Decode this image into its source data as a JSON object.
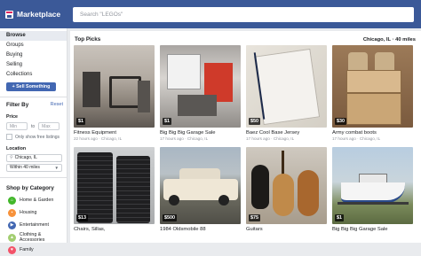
{
  "app": {
    "title": "Marketplace"
  },
  "search": {
    "placeholder": "Search \"LEGOs\""
  },
  "sidebar": {
    "nav": [
      "Browse",
      "Groups",
      "Buying",
      "Selling",
      "Collections"
    ],
    "sell_label": "+ Sell Something",
    "filter_title": "Filter By",
    "reset_label": "Reset",
    "price_label": "Price",
    "min_placeholder": "Min",
    "to_label": "to",
    "max_placeholder": "Max",
    "free_label": "Only show free listings",
    "location_label": "Location",
    "location_value": "Chicago, IL",
    "radius_value": "Within 40 miles",
    "category_title": "Shop by Category",
    "categories": [
      {
        "label": "Home & Garden",
        "icon": "house-icon",
        "color": "#42b72a"
      },
      {
        "label": "Housing",
        "icon": "housing-icon",
        "color": "#f7923b"
      },
      {
        "label": "Entertainment",
        "icon": "entertainment-icon",
        "color": "#4267b2"
      },
      {
        "label": "Clothing & Accessories",
        "icon": "clothing-icon",
        "color": "#a3ce71"
      },
      {
        "label": "Family",
        "icon": "family-icon",
        "color": "#f35369"
      }
    ]
  },
  "main": {
    "section_title": "Top Picks",
    "location": "Chicago, IL · 40 miles",
    "listings": [
      {
        "price": "$1",
        "title": "Fitness Equipment",
        "meta": "22 hours ago · Chicago, IL"
      },
      {
        "price": "$1",
        "title": "Big Big Big Garage Sale",
        "meta": "17 hours ago · Chicago, IL"
      },
      {
        "price": "$50",
        "title": "Baez Cool Base Jersey",
        "meta": "17 hours ago · Chicago, IL"
      },
      {
        "price": "$30",
        "title": "Army combat boots",
        "meta": "17 hours ago · Chicago, IL"
      },
      {
        "price": "$13",
        "title": "Chairs, Sillas,",
        "meta": ""
      },
      {
        "price": "$500",
        "title": "1984 Oldsmobile 88",
        "meta": ""
      },
      {
        "price": "$75",
        "title": "Guitars",
        "meta": ""
      },
      {
        "price": "$1",
        "title": "Big Big Big Garage Sale",
        "meta": ""
      }
    ]
  },
  "colors": {
    "brand": "#3b5998",
    "accent": "#4267b2"
  }
}
